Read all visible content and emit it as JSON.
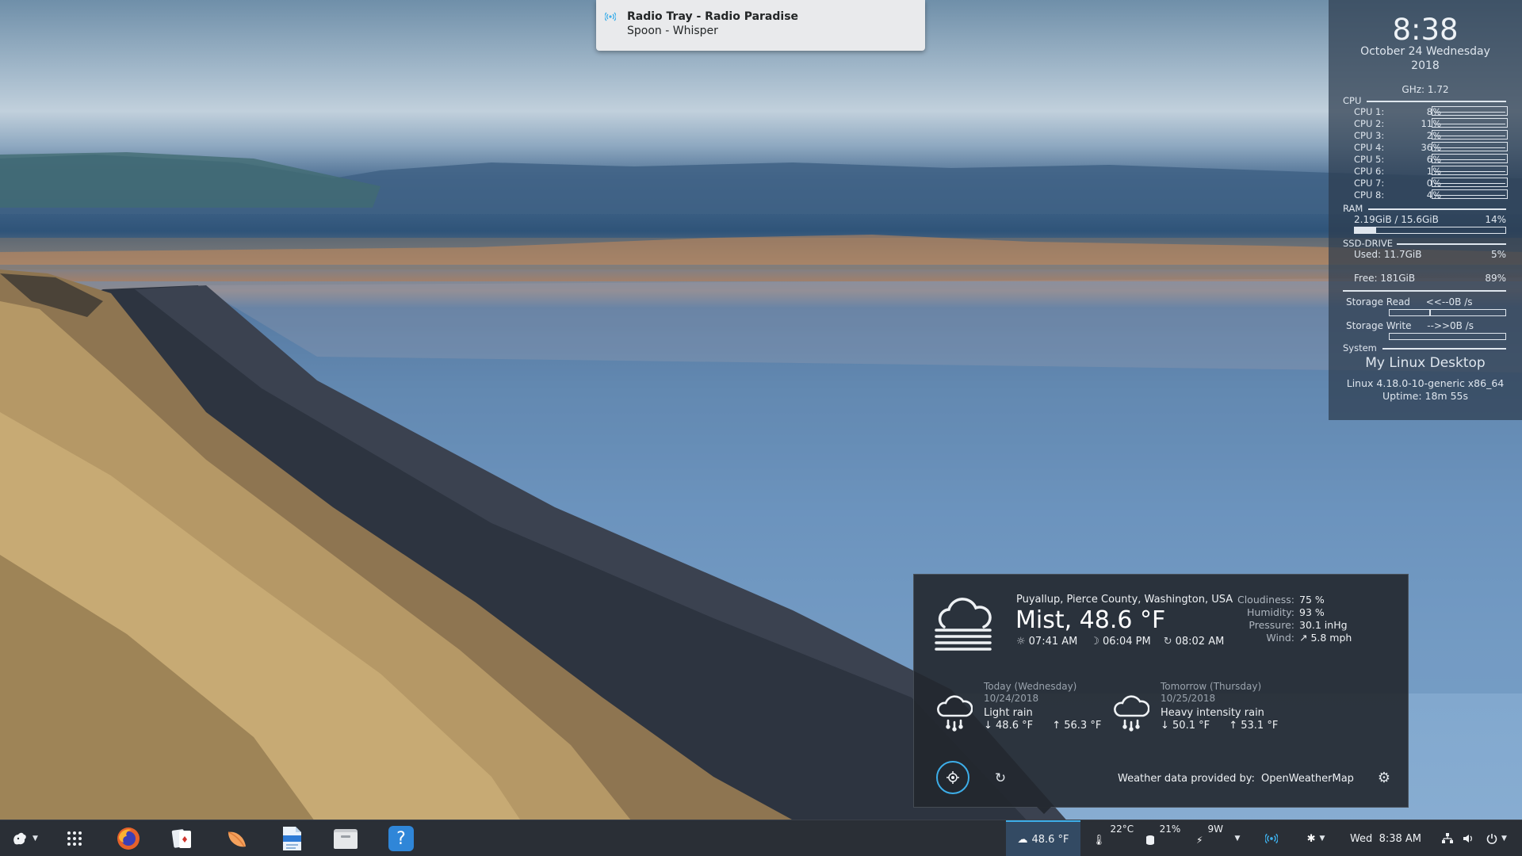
{
  "notification": {
    "title": "Radio Tray - Radio Paradise",
    "body": "Spoon - Whisper",
    "icon": "radio-signal-icon"
  },
  "conky": {
    "time": "8:38",
    "date": "October 24 Wednesday",
    "year": "2018",
    "ghz": "GHz: 1.72",
    "cpu_header": "CPU",
    "cpus": [
      {
        "label": "CPU 1:",
        "pct": "8%"
      },
      {
        "label": "CPU 2:",
        "pct": "11%"
      },
      {
        "label": "CPU 3:",
        "pct": "2%"
      },
      {
        "label": "CPU 4:",
        "pct": "36%"
      },
      {
        "label": "CPU 5:",
        "pct": "6%"
      },
      {
        "label": "CPU 6:",
        "pct": "1%"
      },
      {
        "label": "CPU 7:",
        "pct": "0%"
      },
      {
        "label": "CPU 8:",
        "pct": "4%"
      }
    ],
    "ram_header": "RAM",
    "ram_text": "2.19GiB / 15.6GiB",
    "ram_pct": "14%",
    "ram_fraction": 0.14,
    "ssd_header": "SSD-DRIVE",
    "ssd_used": "Used:  11.7GiB",
    "ssd_used_pct": "5%",
    "ssd_free": "Free:  181GiB",
    "ssd_free_pct": "89%",
    "storage_read_label": "Storage Read",
    "storage_read_value": "<<--0B  /s",
    "storage_write_label": "Storage Write",
    "storage_write_value": "-->>0B  /s",
    "system_header": "System",
    "hostname": "My Linux Desktop",
    "kernel": "Linux 4.18.0-10-generic x86_64",
    "uptime": "Uptime: 18m 55s"
  },
  "weather": {
    "location": "Puyallup, Pierce County, Washington, USA",
    "condition": "Mist, 48.6 °F",
    "sunrise": "07:41 AM",
    "sunset": "06:04 PM",
    "updated": "08:02 AM",
    "details": [
      {
        "key": "Cloudiness:",
        "value": "75 %"
      },
      {
        "key": "Humidity:",
        "value": "93 %"
      },
      {
        "key": "Pressure:",
        "value": "30.1 inHg"
      },
      {
        "key": "Wind:",
        "value": "↗ 5.8 mph"
      }
    ],
    "forecast": [
      {
        "day": "Today (Wednesday)",
        "date": "10/24/2018",
        "desc": "Light rain",
        "low": "↓ 48.6 °F",
        "high": "↑ 56.3 °F",
        "icon": "rain-cloud-icon"
      },
      {
        "day": "Tomorrow (Thursday)",
        "date": "10/25/2018",
        "desc": "Heavy intensity rain",
        "low": "↓ 50.1 °F",
        "high": "↑ 53.1 °F",
        "icon": "rain-cloud-icon"
      }
    ],
    "provider_label": "Weather data provided by:",
    "provider_name": "OpenWeatherMap"
  },
  "taskbar": {
    "weather_temp": "48.6 °F",
    "cpu_temp": "22°C",
    "disk_pct": "21%",
    "power": "9W",
    "clock": "Wed  8:38 AM",
    "apps": [
      "app-launcher-icon",
      "app-grid-icon",
      "firefox-icon",
      "cards-game-icon",
      "peach-app-icon",
      "document-editor-icon",
      "file-manager-icon",
      "help-icon"
    ]
  },
  "colors": {
    "accent": "#3daee9",
    "panel": "#2a2f36"
  }
}
